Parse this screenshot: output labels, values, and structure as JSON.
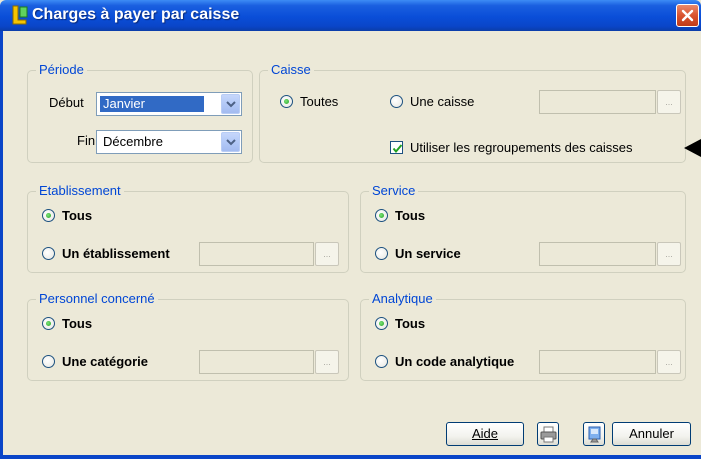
{
  "window": {
    "title": "Charges à payer par caisse"
  },
  "periode": {
    "legend": "Période",
    "debut_label": "Début",
    "debut_value": "Janvier",
    "fin_label": "Fin",
    "fin_value": "Décembre"
  },
  "caisse": {
    "legend": "Caisse",
    "toutes_label": "Toutes",
    "une_caisse_label": "Une caisse",
    "regroupement_label": "Utiliser les regroupements des caisses",
    "selected": "toutes",
    "regroupement_checked": true
  },
  "etablissement": {
    "legend": "Etablissement",
    "tous_label": "Tous",
    "un_label": "Un établissement",
    "selected": "tous"
  },
  "service": {
    "legend": "Service",
    "tous_label": "Tous",
    "un_label": "Un service",
    "selected": "tous"
  },
  "personnel": {
    "legend": "Personnel concerné",
    "tous_label": "Tous",
    "un_label": "Une catégorie",
    "selected": "tous"
  },
  "analytique": {
    "legend": "Analytique",
    "tous_label": "Tous",
    "un_label": "Un code analytique",
    "selected": "tous"
  },
  "browse_button": {
    "label": "..."
  },
  "footer": {
    "aide_label": "Aide",
    "annuler_label": "Annuler"
  },
  "icons": {
    "app": "app-logo-icon",
    "close": "close-icon",
    "printer": "printer-icon",
    "preview": "preview-icon",
    "dropdown": "chevron-down-icon",
    "pointer": "pointer-arrow-icon"
  },
  "colors": {
    "titlebar": "#0a4ed8",
    "legend": "#0046d5",
    "selection": "#316ac5",
    "close_button": "#d9532f",
    "radio_on": "#21a121"
  }
}
